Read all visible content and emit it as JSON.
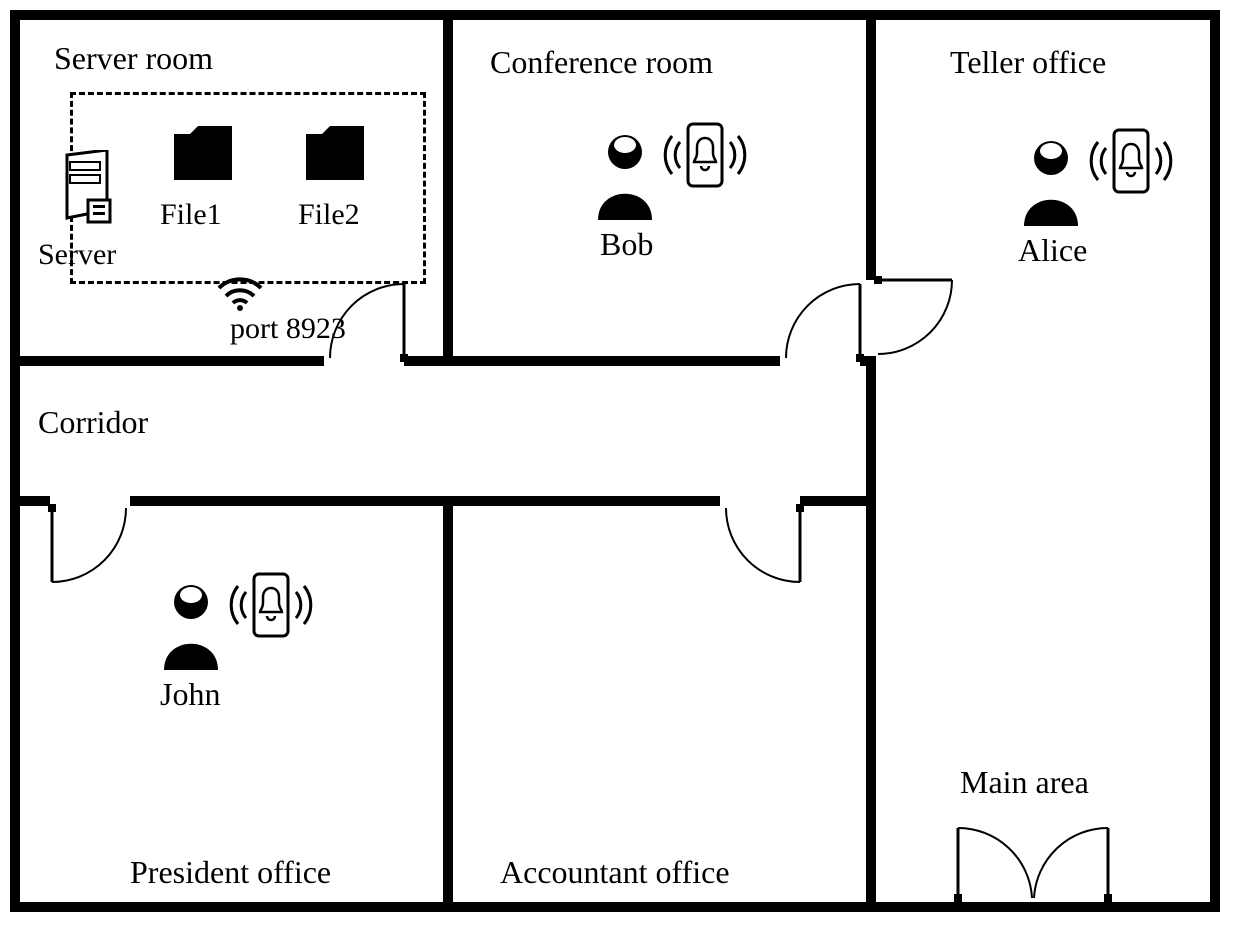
{
  "rooms": {
    "server_room": "Server room",
    "conference_room": "Conference room",
    "teller_office": "Teller office",
    "corridor": "Corridor",
    "president_office": "President office",
    "accountant_office": "Accountant office",
    "main_area": "Main area"
  },
  "server_area": {
    "server_label": "Server",
    "file1_label": "File1",
    "file2_label": "File2",
    "port_label": "port 8923"
  },
  "people": {
    "bob": "Bob",
    "alice": "Alice",
    "john": "John"
  }
}
